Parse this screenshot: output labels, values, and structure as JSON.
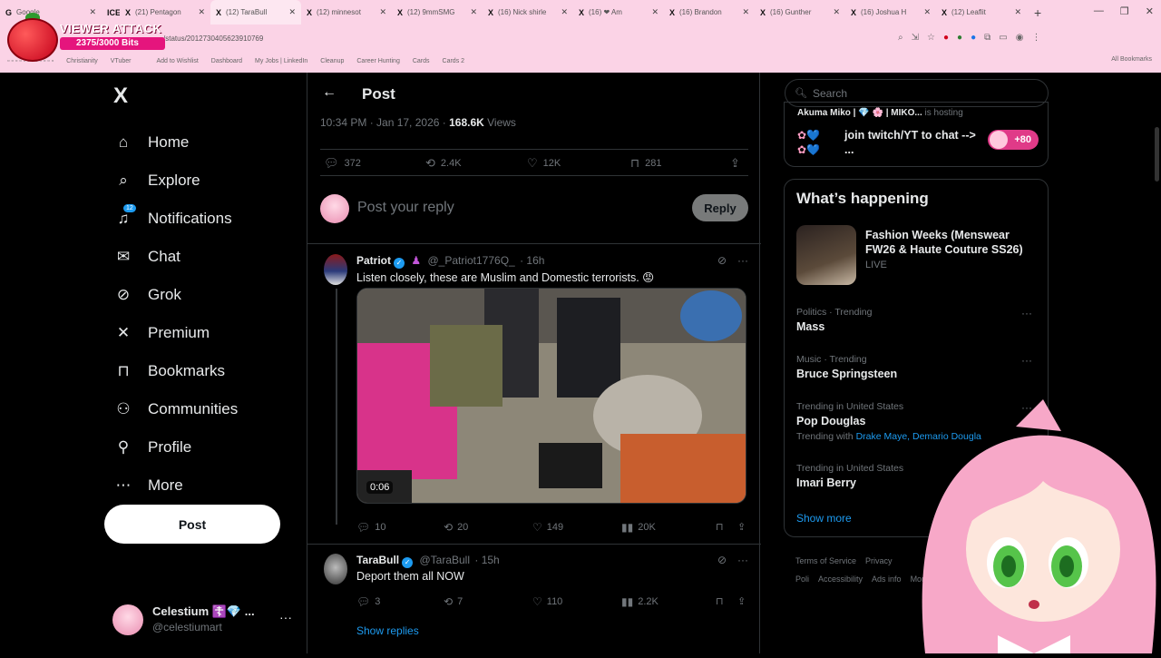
{
  "browser": {
    "tabs": [
      {
        "icon": "G",
        "title": "Google"
      },
      {
        "icon": "ICE",
        "title": ""
      },
      {
        "icon": "X",
        "title": "(21) Pentagon"
      },
      {
        "icon": "X",
        "title": "(12) TaraBull"
      },
      {
        "icon": "X",
        "title": "(12) minnesot"
      },
      {
        "icon": "X",
        "title": "(12) 9mmSMG"
      },
      {
        "icon": "X",
        "title": "(16) Nick shirle"
      },
      {
        "icon": "X",
        "title": "(16) ❤ Am"
      },
      {
        "icon": "X",
        "title": "(16) Brandon"
      },
      {
        "icon": "X",
        "title": "(16) Gunther"
      },
      {
        "icon": "X",
        "title": "(16) Joshua H"
      },
      {
        "icon": "X",
        "title": "(12) Leaflit"
      }
    ],
    "url": "/status/2012730405623910769",
    "bookmarks": [
      "Christianity",
      "VTuber",
      "",
      "Add to Wishlist",
      "Dashboard",
      "My Jobs | LinkedIn",
      "Cleanup",
      "Career Hunting",
      "Cards",
      "Cards 2"
    ],
    "all_bookmarks": "All Bookmarks"
  },
  "overlay": {
    "title": "VIEWER ATTACK",
    "progress": "2375/3000 Bits"
  },
  "nav": {
    "logo": "X",
    "items": [
      {
        "label": "Home",
        "icon": "home-icon"
      },
      {
        "label": "Explore",
        "icon": "search-icon"
      },
      {
        "label": "Notifications",
        "icon": "bell-icon"
      },
      {
        "label": "Chat",
        "icon": "mail-icon"
      },
      {
        "label": "Grok",
        "icon": "grok-icon"
      },
      {
        "label": "Premium",
        "icon": "x-icon"
      },
      {
        "label": "Bookmarks",
        "icon": "bookmark-icon"
      },
      {
        "label": "Communities",
        "icon": "people-icon"
      },
      {
        "label": "Profile",
        "icon": "person-icon"
      },
      {
        "label": "More",
        "icon": "more-circle-icon"
      }
    ],
    "notif_count": "12",
    "post_button": "Post",
    "account": {
      "name": "Celestium ☦️💎 ...",
      "handle": "@celestiumart"
    }
  },
  "post": {
    "header": "Post",
    "time": "10:34 PM · Jan 17, 2026 · ",
    "views_count": "168.6K",
    "views_label": " Views",
    "stats": {
      "replies": "372",
      "reposts": "2.4K",
      "likes": "12K",
      "bookmarks": "281"
    },
    "reply_placeholder": "Post your reply",
    "reply_button": "Reply"
  },
  "replies": [
    {
      "name": "Patriot",
      "handle": "@_Patriot1776Q_",
      "age": "· 16h",
      "text": "Listen closely, these are Muslim and Domestic terrorists. 😡",
      "video_time": "0:06",
      "stats": {
        "replies": "10",
        "reposts": "20",
        "likes": "149",
        "views": "20K"
      }
    },
    {
      "name": "TaraBull",
      "handle": "@TaraBull",
      "age": "· 15h",
      "text": "Deport them all NOW",
      "stats": {
        "replies": "3",
        "reposts": "7",
        "likes": "110",
        "views": "2.2K"
      }
    }
  ],
  "show_replies": "Show replies",
  "sidebar": {
    "search_placeholder": "Search",
    "live": {
      "host": "Akuma Miko | 💎 🌸 |  MIKO...",
      "host_suffix": " is hosting",
      "message": "join twitch/YT to chat --> ...",
      "count": "+80"
    },
    "whats_happening": "What’s happening",
    "featured": {
      "title": "Fashion Weeks (Menswear FW26 & Haute Couture SS26)",
      "status": "LIVE"
    },
    "trends": [
      {
        "context": "Politics · Trending",
        "name": "Mass",
        "with": ""
      },
      {
        "context": "Music · Trending",
        "name": "Bruce Springsteen",
        "with": ""
      },
      {
        "context": "Trending in United States",
        "name": "Pop Douglas",
        "with_prefix": "Trending with ",
        "with": "Drake Maye, Demario Dougla"
      },
      {
        "context": "Trending in United States",
        "name": "Imari Berry",
        "with": ""
      }
    ],
    "show_more": "Show more",
    "footer": [
      "Terms of Service",
      "Privacy Poli",
      "Accessibility",
      "Ads info",
      "More"
    ]
  },
  "colors": {
    "accent": "#1d9bf0",
    "background": "#000000",
    "chrome": "#fbd3e6"
  }
}
